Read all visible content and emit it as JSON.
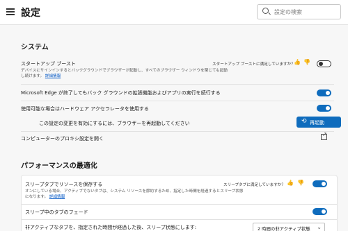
{
  "header": {
    "title": "設定",
    "search_placeholder": "設定の検索"
  },
  "system": {
    "title": "システム",
    "startup_boost": {
      "label": "スタートアップ ブースト",
      "description": "デバイスにサインインするとバックグラウンドでブラウザーが起動し、すべてのブラウザー ウィンドウを閉じても起動し続けます。",
      "link": "詳細情報",
      "feedback": "スタートアップ ブーストに満足していますか？",
      "enabled": false
    },
    "background_apps": {
      "label": "Microsoft Edge が終了してもバック グラウンドの拡張機能およびアプリの実行を続行する",
      "enabled": true
    },
    "hardware_accel": {
      "label": "使用可能な場合はハードウェア アクセラレータを使用する",
      "enabled": true
    },
    "restart_notice": "この設定の変更を有効にするには、ブラウザーを再起動してください",
    "restart_button": "再起動",
    "proxy_label": "コンピューターのプロキシ設定を開く"
  },
  "performance": {
    "title": "パフォーマンスの最適化",
    "sleeping_tabs": {
      "label": "スリープタブでリソースを保存する",
      "description": "オンにしている場合、アクティブでないタブは、システム リソースを節約するため、指定した時間を経過するとスリープ状態になります。",
      "link": "詳細情報",
      "feedback": "スリープタブに満足していますか？",
      "enabled": true
    },
    "fade_tabs": {
      "label": "スリープ中のタブのフェード",
      "enabled": true
    },
    "inactive_tabs": {
      "label": "非アクティブなタブを、指定された時間が経過した後、スリープ状態にします:",
      "value": "2 時間の非アクティブ状態"
    }
  },
  "icons": {
    "menu": "hamburger-icon",
    "search": "search-icon",
    "thumbs_up": "thumbs-up-icon",
    "thumbs_down": "thumbs-down-icon",
    "restart": "refresh-icon",
    "external": "external-link-icon",
    "dropdown": "chevron-down-icon"
  },
  "colors": {
    "accent": "#0f6cbd",
    "link": "#0a5cc7"
  }
}
